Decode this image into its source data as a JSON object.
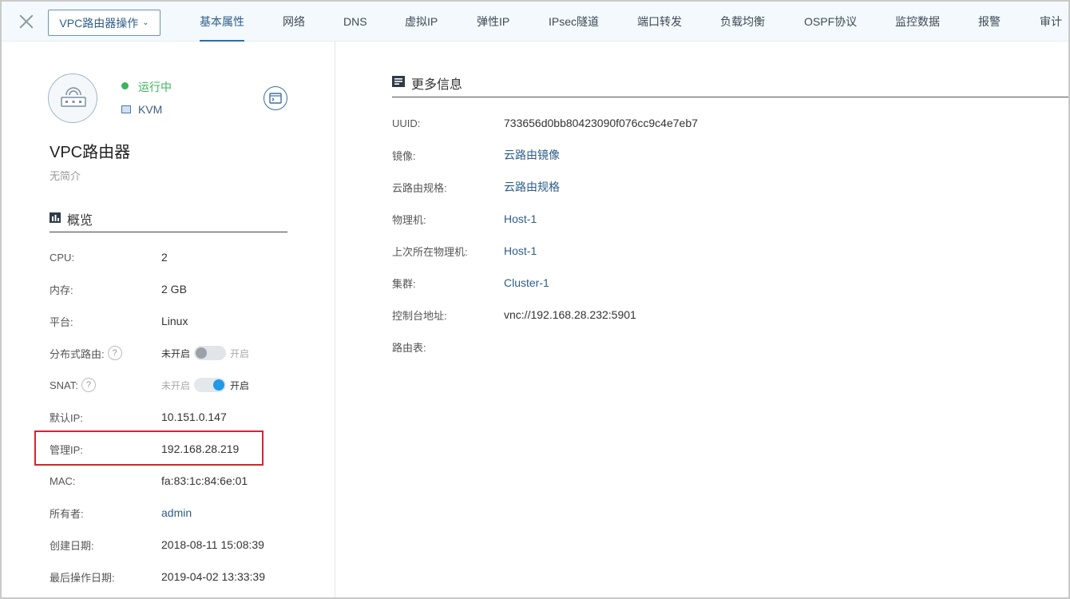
{
  "header": {
    "ops_button": "VPC路由器操作",
    "tabs": [
      "基本属性",
      "网络",
      "DNS",
      "虚拟IP",
      "弹性IP",
      "IPsec隧道",
      "端口转发",
      "负载均衡",
      "OSPF协议",
      "监控数据",
      "报警",
      "审计"
    ],
    "active_tab": "基本属性"
  },
  "summary": {
    "status": "运行中",
    "hypervisor": "KVM",
    "name": "VPC路由器",
    "description": "无简介",
    "status_color": "#3ab55c"
  },
  "overview": {
    "title": "概览",
    "rows": [
      {
        "label": "CPU:",
        "value": "2"
      },
      {
        "label": "内存:",
        "value": "2 GB"
      },
      {
        "label": "平台:",
        "value": "Linux"
      },
      {
        "label": "分布式路由:",
        "toggle_off": "未开启",
        "toggle_on": "开启",
        "enabled": false
      },
      {
        "label": "SNAT:",
        "toggle_off": "未开启",
        "toggle_on": "开启",
        "enabled": true
      },
      {
        "label": "默认IP:",
        "value": "10.151.0.147"
      },
      {
        "label": "管理IP:",
        "value": "192.168.28.219"
      },
      {
        "label": "MAC:",
        "value": "fa:83:1c:84:6e:01"
      },
      {
        "label": "所有者:",
        "value": "admin"
      },
      {
        "label": "创建日期:",
        "value": "2018-08-11 15:08:39"
      },
      {
        "label": "最后操作日期:",
        "value": "2019-04-02 13:33:39"
      }
    ]
  },
  "more_info": {
    "title": "更多信息",
    "rows": [
      {
        "label": "UUID:",
        "value": "733656d0bb80423090f076cc9c4e7eb7"
      },
      {
        "label": "镜像:",
        "value": "云路由镜像"
      },
      {
        "label": "云路由规格:",
        "value": "云路由规格"
      },
      {
        "label": "物理机:",
        "value": "Host-1"
      },
      {
        "label": "上次所在物理机:",
        "value": "Host-1"
      },
      {
        "label": "集群:",
        "value": "Cluster-1"
      },
      {
        "label": "控制台地址:",
        "value": "vnc://192.168.28.232:5901"
      },
      {
        "label": "路由表:",
        "value": ""
      }
    ]
  },
  "colors": {
    "accent": "#2d5d8a",
    "highlight": "#d6252d",
    "toggle_on": "#1f9ae8"
  }
}
